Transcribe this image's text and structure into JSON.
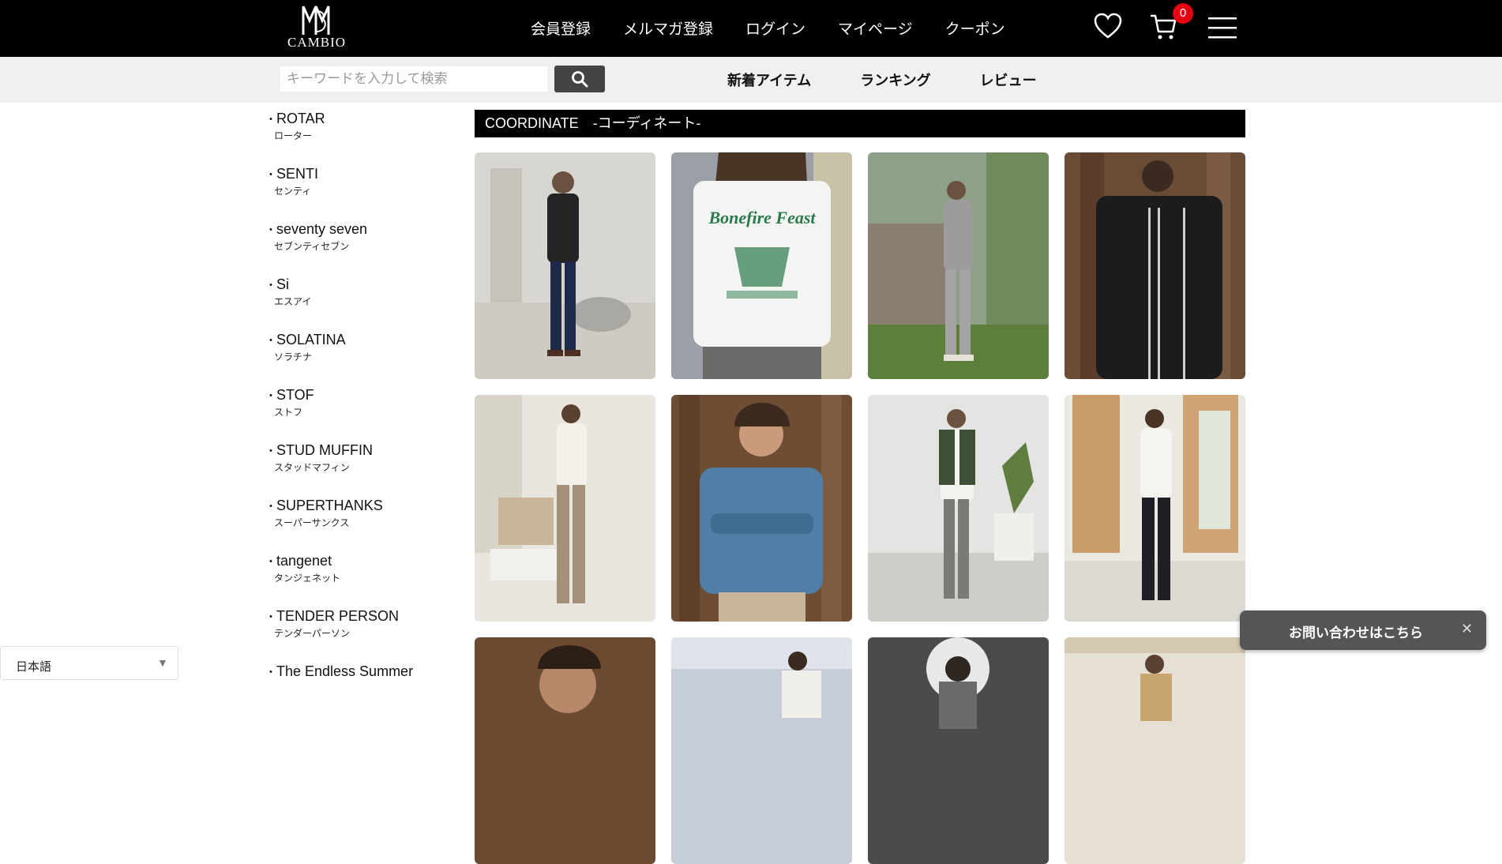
{
  "header": {
    "logo_text": "CAMBIO",
    "nav": [
      "会員登録",
      "メルマガ登録",
      "ログイン",
      "マイページ",
      "クーポン"
    ],
    "cart_count": "0"
  },
  "search": {
    "placeholder": "キーワードを入力して検索"
  },
  "subnav": [
    "新着アイテム",
    "ランキング",
    "レビュー"
  ],
  "sidebar": {
    "brands": [
      {
        "en": "ROTAR",
        "jp": "ローター"
      },
      {
        "en": "SENTI",
        "jp": "センティ"
      },
      {
        "en": "seventy seven",
        "jp": "セブンティセブン"
      },
      {
        "en": "Si",
        "jp": "エスアイ"
      },
      {
        "en": "SOLATINA",
        "jp": "ソラチナ"
      },
      {
        "en": "STOF",
        "jp": "ストフ"
      },
      {
        "en": "STUD MUFFIN",
        "jp": "スタッドマフィン"
      },
      {
        "en": "SUPERTHANKS",
        "jp": "スーパーサンクス"
      },
      {
        "en": "tangenet",
        "jp": "タンジェネット"
      },
      {
        "en": "TENDER PERSON",
        "jp": "テンダーパーソン"
      },
      {
        "en": "The Endless Summer",
        "jp": ""
      }
    ]
  },
  "main": {
    "section_title": "COORDINATE　-コーディネート-",
    "tile2_print": "Bonefire Feast"
  },
  "language": {
    "selected": "日本語"
  },
  "contact": {
    "label": "お問い合わせはこちら"
  }
}
